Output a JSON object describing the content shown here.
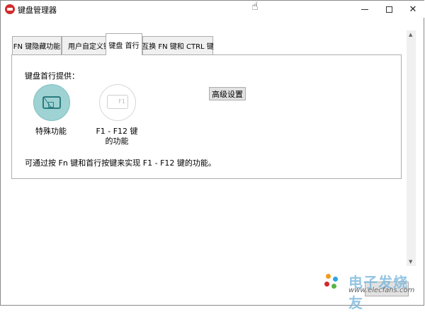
{
  "window": {
    "title": "键盘管理器",
    "close_glyph": "✕"
  },
  "tabs": [
    {
      "label": "FN 键隐藏功能"
    },
    {
      "label": "用户自定义键"
    },
    {
      "label": "键盘 首行"
    },
    {
      "label": "互换 FN 键和 CTRL 键"
    }
  ],
  "panel": {
    "heading": "键盘首行提供：",
    "option1_label": "特殊功能",
    "option2_label": "F1 - F12 键\n的功能",
    "option2_icon_text": "F1",
    "advanced_button": "高级设置",
    "description": "可通过按 Fn 键和首行按键来实现 F1 - F12 键的功能。"
  },
  "scrollbar": {
    "up": "▲",
    "down": "▼"
  },
  "watermark": {
    "text": "电子发烧友",
    "url": "www.elecfans.com"
  },
  "colors": {
    "selected_option": "#9fd2d3",
    "brand_red": "#d32b2b"
  }
}
